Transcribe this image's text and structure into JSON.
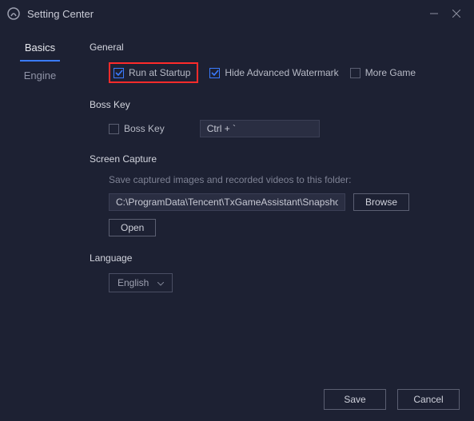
{
  "window": {
    "title": "Setting Center"
  },
  "sidebar": {
    "items": [
      {
        "label": "Basics"
      },
      {
        "label": "Engine"
      }
    ],
    "activeIndex": 0
  },
  "sections": {
    "general": {
      "title": "General",
      "runAtStartup": {
        "label": "Run at Startup",
        "checked": true,
        "highlighted": true
      },
      "hideWatermark": {
        "label": "Hide Advanced Watermark",
        "checked": true
      },
      "moreGame": {
        "label": "More Game",
        "checked": false
      }
    },
    "bossKey": {
      "title": "Boss Key",
      "checkbox": {
        "label": "Boss Key",
        "checked": false
      },
      "shortcut": "Ctrl + `"
    },
    "screenCapture": {
      "title": "Screen Capture",
      "caption": "Save captured images and recorded videos to this folder:",
      "path": "C:\\ProgramData\\Tencent\\TxGameAssistant\\Snapshot",
      "browse": "Browse",
      "open": "Open"
    },
    "language": {
      "title": "Language",
      "selected": "English"
    }
  },
  "footer": {
    "save": "Save",
    "cancel": "Cancel"
  }
}
